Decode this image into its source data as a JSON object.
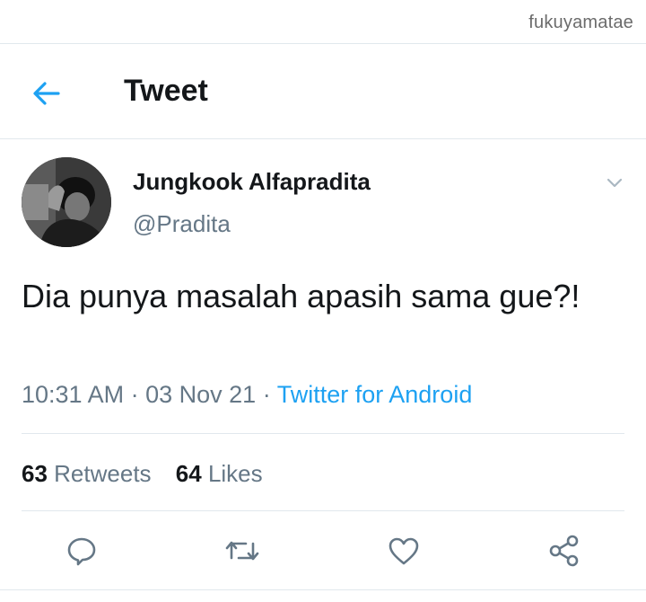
{
  "watermark": "fukuyamatae",
  "header": {
    "title": "Tweet",
    "back_icon": "arrow-left-icon"
  },
  "tweet": {
    "display_name": "Jungkook Alfapradita",
    "handle": "@Pradita",
    "text": "Dia punya masalah apasih sama gue?!",
    "time": "10:31 AM",
    "date": "03 Nov 21",
    "separator": "·",
    "source": "Twitter for Android"
  },
  "stats": {
    "retweets_count": "63",
    "retweets_label": "Retweets",
    "likes_count": "64",
    "likes_label": "Likes"
  },
  "actions": [
    "reply-icon",
    "retweet-icon",
    "like-icon",
    "share-icon"
  ],
  "colors": {
    "accent": "#1da1f2",
    "text": "#14171a",
    "secondary": "#657786",
    "divider": "#e1e8ed",
    "icon": "#657786"
  }
}
